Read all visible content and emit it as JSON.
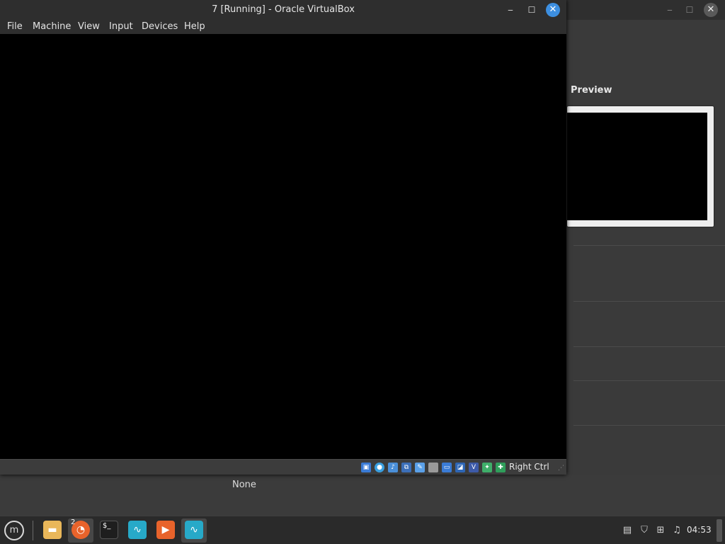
{
  "vm_window": {
    "title": "7 [Running] - Oracle VirtualBox",
    "menu": [
      "File",
      "Machine",
      "View",
      "Input",
      "Devices",
      "Help"
    ],
    "host_key": "Right Ctrl"
  },
  "manager": {
    "preview_header": "Preview",
    "bottom_value": "None"
  },
  "taskbar": {
    "clock": "04:53",
    "badge": "2",
    "apps": [
      "files-app",
      "browser-app",
      "terminal-app",
      "virtualbox-app",
      "media-player-app",
      "virtualbox-app"
    ]
  },
  "colors": {
    "accent": "#3d8fe0",
    "screen": "#000000",
    "folder": "#e9b75a",
    "orange": "#e8632b",
    "teal": "#27a9c8"
  },
  "icons": {
    "status": [
      "hard-disk-icon",
      "optical-drive-icon",
      "audio-icon",
      "network-icon",
      "usb-icon",
      "shared-folder-icon",
      "display-icon",
      "recording-icon",
      "cpu-icon",
      "mouse-integration-icon",
      "keyboard-icon"
    ],
    "tray": [
      "clipboard-icon",
      "shield-icon",
      "network-tray-icon",
      "sound-icon"
    ]
  }
}
